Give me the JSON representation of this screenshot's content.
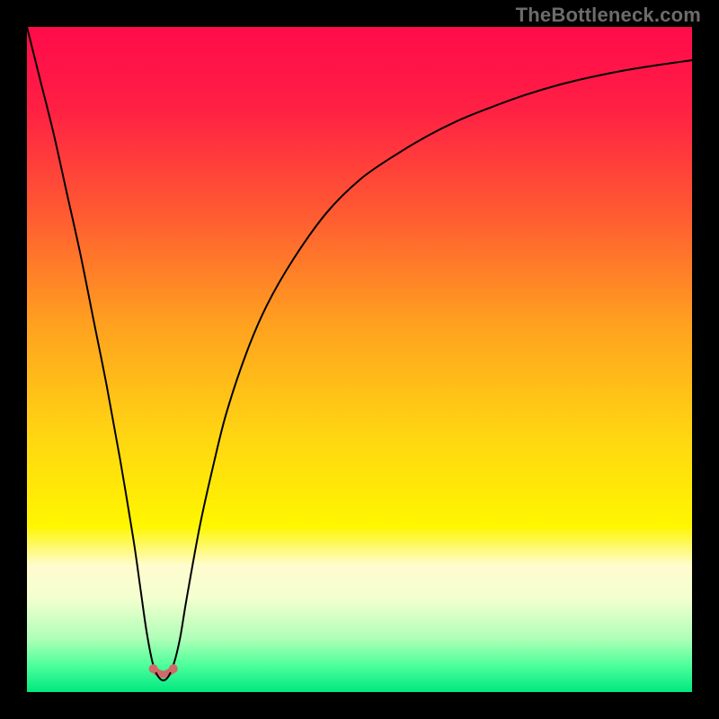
{
  "watermark": {
    "text": "TheBottleneck.com",
    "color": "#6c6c6c"
  },
  "chart_data": {
    "type": "line",
    "title": "",
    "xlabel": "",
    "ylabel": "",
    "xlim": [
      0,
      100
    ],
    "ylim": [
      0,
      100
    ],
    "gradient_stops": [
      {
        "offset": 0,
        "color": "#ff0b4a"
      },
      {
        "offset": 12,
        "color": "#ff1f44"
      },
      {
        "offset": 28,
        "color": "#ff5a32"
      },
      {
        "offset": 45,
        "color": "#ffa21f"
      },
      {
        "offset": 62,
        "color": "#ffd712"
      },
      {
        "offset": 75,
        "color": "#fff600"
      },
      {
        "offset": 81,
        "color": "#fffccf"
      },
      {
        "offset": 86,
        "color": "#f3ffcf"
      },
      {
        "offset": 92,
        "color": "#aeffb7"
      },
      {
        "offset": 96,
        "color": "#4dff9b"
      },
      {
        "offset": 100,
        "color": "#00e880"
      }
    ],
    "series": [
      {
        "name": "bottleneck-curve",
        "color": "#000000",
        "width": 2,
        "x": [
          0,
          2,
          4,
          6,
          8,
          10,
          12,
          14,
          16,
          17,
          18,
          19,
          20,
          21,
          22,
          23,
          24,
          26,
          28,
          30,
          33,
          36,
          40,
          45,
          50,
          55,
          60,
          65,
          70,
          75,
          80,
          85,
          90,
          95,
          100
        ],
        "values": [
          100,
          92,
          84,
          75,
          66,
          56,
          46,
          35,
          23,
          16,
          9,
          4,
          2,
          2,
          4,
          8,
          14,
          25,
          34,
          42,
          51,
          58,
          65,
          72,
          77,
          80.5,
          83.5,
          86,
          88,
          89.8,
          91.3,
          92.5,
          93.5,
          94.3,
          95
        ]
      }
    ],
    "markers": [
      {
        "name": "trough-left",
        "x": 19,
        "y": 3.5,
        "r": 5,
        "color": "#d06a6a"
      },
      {
        "name": "trough-right",
        "x": 22,
        "y": 3.5,
        "r": 5,
        "color": "#d06a6a"
      }
    ],
    "marker_connector": {
      "from": {
        "x": 19,
        "y": 3.5
      },
      "to": {
        "x": 22,
        "y": 3.5
      },
      "dip_y": 1.8,
      "color": "#d06a6a",
      "width": 8
    }
  }
}
